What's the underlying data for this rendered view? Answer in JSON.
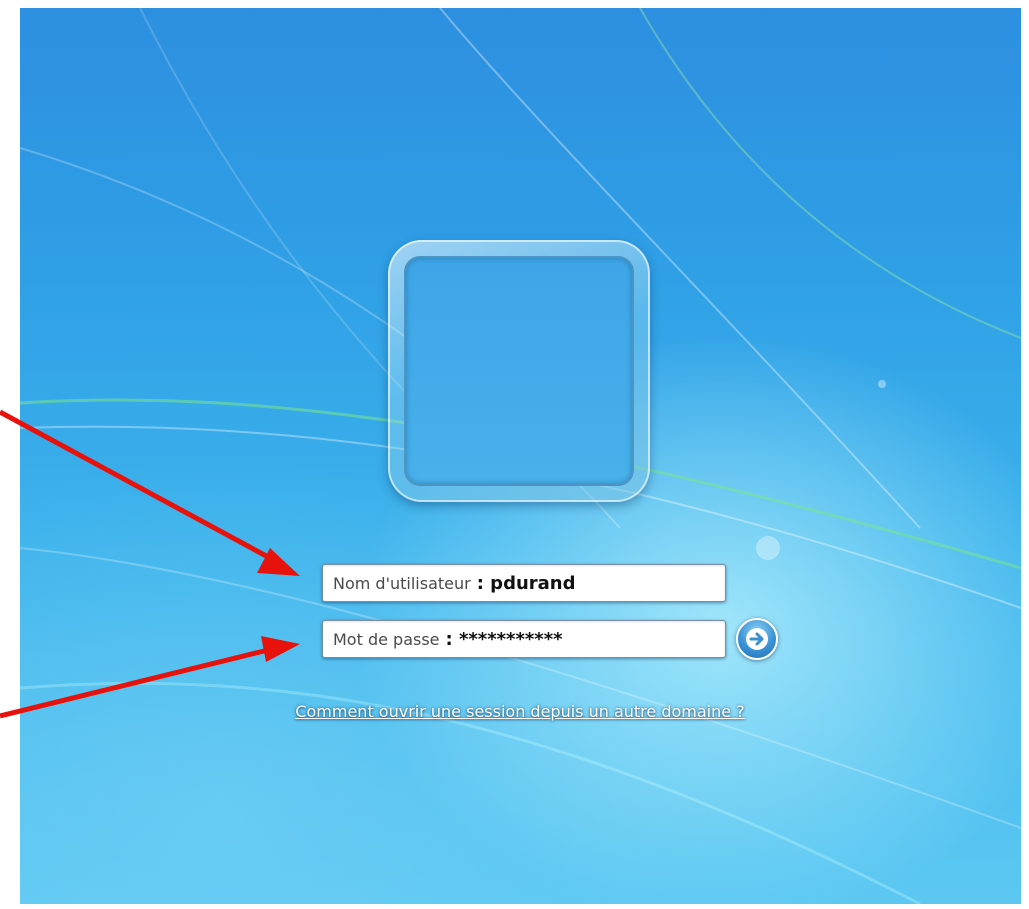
{
  "login": {
    "username_label": "Nom d'utilisateur",
    "username_value": ": pdurand",
    "password_label": "Mot de passe",
    "password_value": ": ***********",
    "other_domain_link": "Comment ouvrir une session depuis un autre domaine ?"
  },
  "icons": {
    "submit": "arrow-right-icon",
    "user_tile": "user-picture-frame"
  },
  "colors": {
    "wallpaper": "#3aa8e8",
    "annotation_arrow": "#e8120c",
    "submit_button": "#2f86cc"
  }
}
